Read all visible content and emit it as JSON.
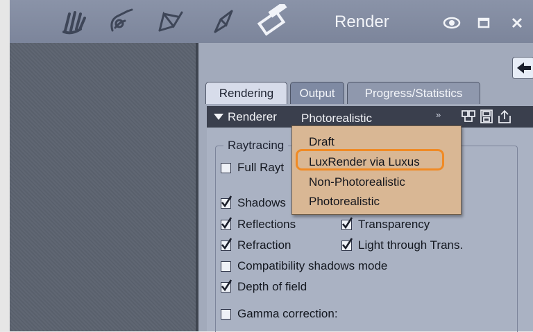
{
  "titlebar": {
    "title": "Render",
    "tool_icons": [
      "hand-pose-icon",
      "brush-face-icon",
      "mesh-pen-icon",
      "pen-tip-icon",
      "render-clapper-icon"
    ],
    "window_buttons": [
      "eye-icon",
      "maximize-icon",
      "close-icon"
    ]
  },
  "tabs": [
    {
      "label": "Rendering",
      "active": true
    },
    {
      "label": "Output",
      "active": false
    },
    {
      "label": "Progress/Statistics",
      "active": false
    }
  ],
  "renderer": {
    "label": "Renderer",
    "value": "Photorealistic",
    "chevron": "»",
    "icons": [
      "presets-icon",
      "save-icon",
      "export-icon"
    ]
  },
  "dropdown": {
    "options": [
      "Draft",
      "LuxRender via Luxus",
      "Non-Photorealistic",
      "Photorealistic"
    ],
    "highlighted": "LuxRender via Luxus"
  },
  "raytracing": {
    "group_label": "Raytracing",
    "full_raytrace": {
      "label": "Full Rayt",
      "checked": false
    },
    "shadows": {
      "label": "Shadows",
      "checked": true
    },
    "reflections": {
      "label": "Reflections",
      "checked": true
    },
    "transparency": {
      "label": "Transparency",
      "checked": true
    },
    "refraction": {
      "label": "Refraction",
      "checked": true
    },
    "light_through": {
      "label": "Light through Trans.",
      "checked": true
    },
    "compat_shadows": {
      "label": "Compatibility shadows mode",
      "checked": false
    },
    "depth_of_field": {
      "label": "Depth of field",
      "checked": true
    },
    "gamma": {
      "label": "Gamma correction:",
      "checked": false
    }
  },
  "colors": {
    "highlight_outline": "#f08a24",
    "dropdown_bg": "#d9b794",
    "titlebar": "#8a93a8"
  }
}
